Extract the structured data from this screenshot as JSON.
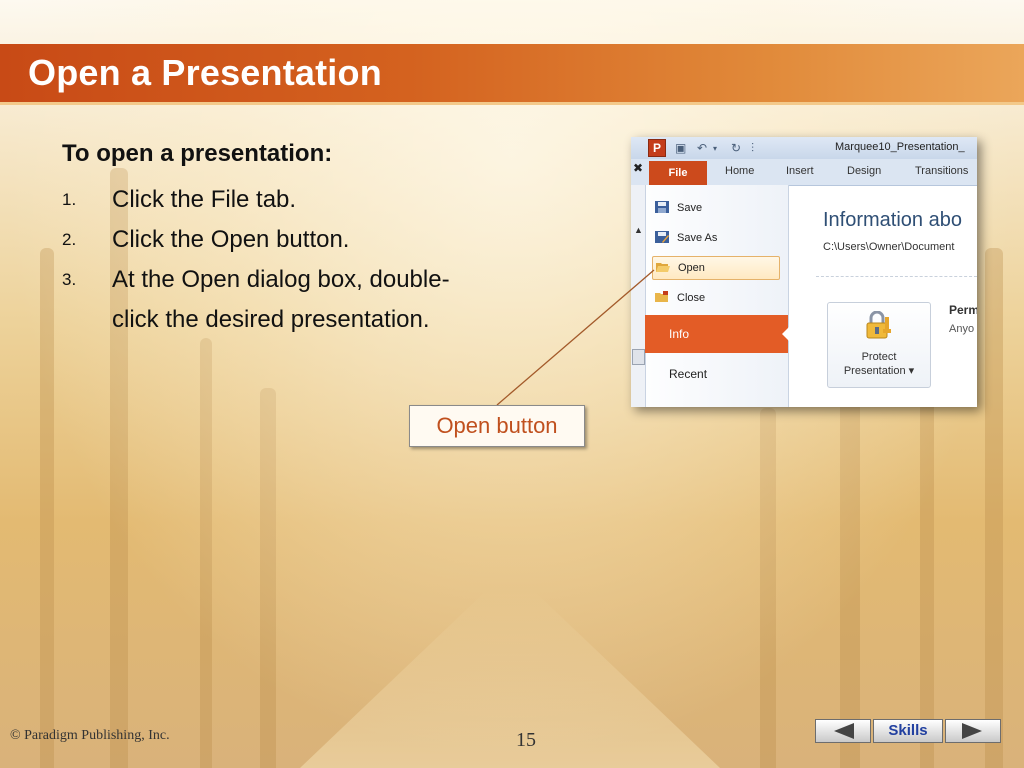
{
  "slide": {
    "title": "Open a Presentation",
    "heading": "To open a presentation:",
    "steps": [
      {
        "num": "1.",
        "text": "Click the File tab."
      },
      {
        "num": "2.",
        "text": "Click the Open button."
      },
      {
        "num": "3.",
        "text": "At the Open dialog box, double-click the desired presentation."
      }
    ],
    "callout": "Open button"
  },
  "screenshot": {
    "app_icon": "P",
    "window_title": "Marquee10_Presentation_",
    "ribbon_tabs": [
      "File",
      "Home",
      "Insert",
      "Design",
      "Transitions"
    ],
    "backstage_items": [
      {
        "label": "Save",
        "icon": "save-icon"
      },
      {
        "label": "Save As",
        "icon": "save-as-icon"
      },
      {
        "label": "Open",
        "icon": "folder-open-icon"
      },
      {
        "label": "Close",
        "icon": "folder-close-icon"
      }
    ],
    "info_label": "Info",
    "recent_label": "Recent",
    "info_heading": "Information abo",
    "info_path": "C:\\Users\\Owner\\Document",
    "protect_line1": "Protect",
    "protect_line2": "Presentation ▾",
    "perm_label": "Perm",
    "anyone_label": "Anyo"
  },
  "footer": {
    "copyright": "© Paradigm Publishing, Inc.",
    "page_number": "15",
    "skills_label": "Skills"
  },
  "colors": {
    "title_bar": "#c84a16",
    "file_tab": "#cc4a1c",
    "callout_text": "#c0501e",
    "skills_text": "#2240a0"
  }
}
